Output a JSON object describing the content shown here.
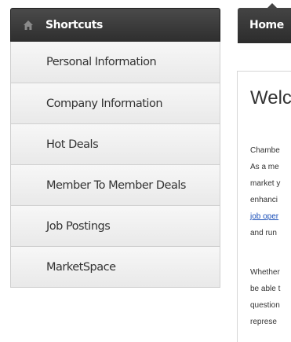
{
  "sidebar": {
    "header": {
      "label": "Shortcuts",
      "icon": "home-icon"
    },
    "items": [
      {
        "label": "Personal Information"
      },
      {
        "label": "Company Information"
      },
      {
        "label": "Hot Deals"
      },
      {
        "label": "Member To Member Deals"
      },
      {
        "label": "Job Postings"
      },
      {
        "label": "MarketSpace"
      }
    ]
  },
  "nav": {
    "home_tab": "Home"
  },
  "content": {
    "title": "Welc",
    "paragraph1": [
      "Chambe",
      "As a me",
      "market y",
      "enhanci",
      "job oper",
      "and run"
    ],
    "paragraph2": [
      "Whether",
      "be able t",
      "question",
      "represe"
    ]
  },
  "colors": {
    "header_bg": "#3a3a3a",
    "item_bg": "#efefef",
    "link": "#1a4fb8"
  }
}
